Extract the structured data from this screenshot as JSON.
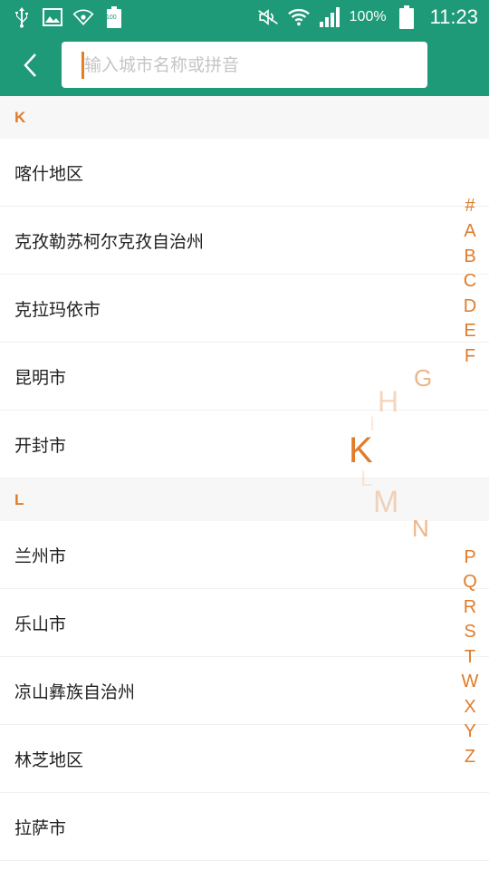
{
  "status": {
    "battery_small": "100",
    "battery_pct": "100%",
    "time": "11:23"
  },
  "search": {
    "placeholder": "输入城市名称或拼音"
  },
  "sections": [
    {
      "letter": "K",
      "cities": [
        "喀什地区",
        "克孜勒苏柯尔克孜自治州",
        "克拉玛依市",
        "昆明市",
        "开封市"
      ]
    },
    {
      "letter": "L",
      "cities": [
        "兰州市",
        "乐山市",
        "凉山彝族自治州",
        "林芝地区",
        "拉萨市"
      ]
    }
  ],
  "index_top": [
    "#",
    "A",
    "B",
    "C",
    "D",
    "E",
    "F"
  ],
  "index_bottom": [
    "P",
    "Q",
    "R",
    "S",
    "T",
    "W",
    "X",
    "Y",
    "Z"
  ],
  "magnifier": {
    "g": "G",
    "h": "H",
    "i": "I",
    "k": "K",
    "l": "L",
    "m": "M",
    "n": "N"
  },
  "colors": {
    "header_green": "#1f9a78",
    "accent_orange": "#e07b2a"
  },
  "icons": {
    "back": "chevron-left",
    "usb": "usb",
    "image": "image",
    "wifi_hotspot": "wifi-hotspot",
    "mute": "mute",
    "wifi": "wifi",
    "signal": "signal",
    "battery": "battery"
  }
}
